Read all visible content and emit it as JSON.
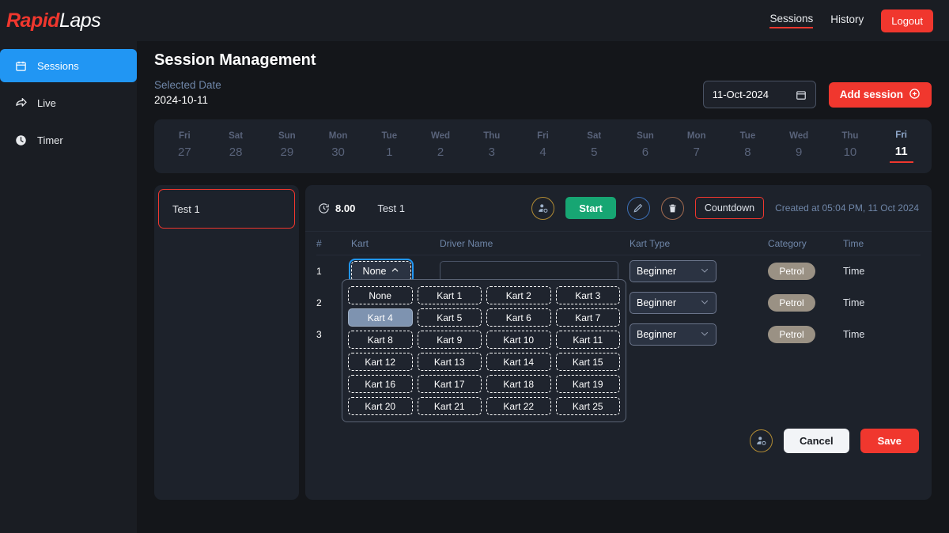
{
  "brand": {
    "part1": "Rapid",
    "part2": "Laps"
  },
  "sidebar": {
    "items": [
      {
        "label": "Sessions",
        "icon": "calendar-icon",
        "active": true
      },
      {
        "label": "Live",
        "icon": "share-icon",
        "active": false
      },
      {
        "label": "Timer",
        "icon": "clock-icon",
        "active": false
      }
    ]
  },
  "topnav": {
    "links": [
      {
        "label": "Sessions",
        "active": true
      },
      {
        "label": "History",
        "active": false
      }
    ],
    "logout_label": "Logout"
  },
  "header": {
    "page_title": "Session Management",
    "selected_date_label": "Selected Date",
    "selected_date_value": "2024-10-11",
    "date_input_value": "11-Oct-2024",
    "add_session_label": "Add session"
  },
  "week_strip": {
    "days": [
      {
        "dow": "Fri",
        "num": "27",
        "selected": false
      },
      {
        "dow": "Sat",
        "num": "28",
        "selected": false
      },
      {
        "dow": "Sun",
        "num": "29",
        "selected": false
      },
      {
        "dow": "Mon",
        "num": "30",
        "selected": false
      },
      {
        "dow": "Tue",
        "num": "1",
        "selected": false
      },
      {
        "dow": "Wed",
        "num": "2",
        "selected": false
      },
      {
        "dow": "Thu",
        "num": "3",
        "selected": false
      },
      {
        "dow": "Fri",
        "num": "4",
        "selected": false
      },
      {
        "dow": "Sat",
        "num": "5",
        "selected": false
      },
      {
        "dow": "Sun",
        "num": "6",
        "selected": false
      },
      {
        "dow": "Mon",
        "num": "7",
        "selected": false
      },
      {
        "dow": "Tue",
        "num": "8",
        "selected": false
      },
      {
        "dow": "Wed",
        "num": "9",
        "selected": false
      },
      {
        "dow": "Thu",
        "num": "10",
        "selected": false
      },
      {
        "dow": "Fri",
        "num": "11",
        "selected": true
      }
    ]
  },
  "session_list": {
    "items": [
      {
        "name": "Test 1",
        "selected": true
      }
    ]
  },
  "detail": {
    "duration": "8.00",
    "name": "Test 1",
    "start_label": "Start",
    "countdown_label": "Countdown",
    "created_at": "Created at 05:04 PM, 11 Oct 2024",
    "cancel_label": "Cancel",
    "save_label": "Save"
  },
  "table": {
    "columns": [
      "#",
      "Kart",
      "Driver Name",
      "Kart Type",
      "Category",
      "Time"
    ],
    "rows": [
      {
        "num": "1",
        "kart": "None",
        "driver": "",
        "driver_placeholder": "",
        "type": "Beginner",
        "category": "Petrol",
        "time": "Time",
        "open": true
      },
      {
        "num": "2",
        "kart": "",
        "driver": "",
        "driver_placeholder": "",
        "type": "Beginner",
        "category": "Petrol",
        "time": "Time",
        "open": false
      },
      {
        "num": "3",
        "kart": "",
        "driver": "",
        "driver_placeholder": "",
        "type": "Beginner",
        "category": "Petrol",
        "time": "Time",
        "open": false
      }
    ]
  },
  "kart_dropdown": {
    "options": [
      "None",
      "Kart 1",
      "Kart 2",
      "Kart 3",
      "Kart 4",
      "Kart 5",
      "Kart 6",
      "Kart 7",
      "Kart 8",
      "Kart 9",
      "Kart 10",
      "Kart 11",
      "Kart 12",
      "Kart 13",
      "Kart 14",
      "Kart 15",
      "Kart 16",
      "Kart 17",
      "Kart 18",
      "Kart 19",
      "Kart 20",
      "Kart 21",
      "Kart 22",
      "Kart 25"
    ],
    "selected": "Kart 4"
  },
  "colors": {
    "brand_red": "#f0372e",
    "accent_blue": "#2196f3",
    "start_green": "#17a673",
    "page_bg": "#14161a",
    "panel_bg": "#1d222b",
    "muted_text": "#6f86a8",
    "category_badge": "#9a9184"
  }
}
